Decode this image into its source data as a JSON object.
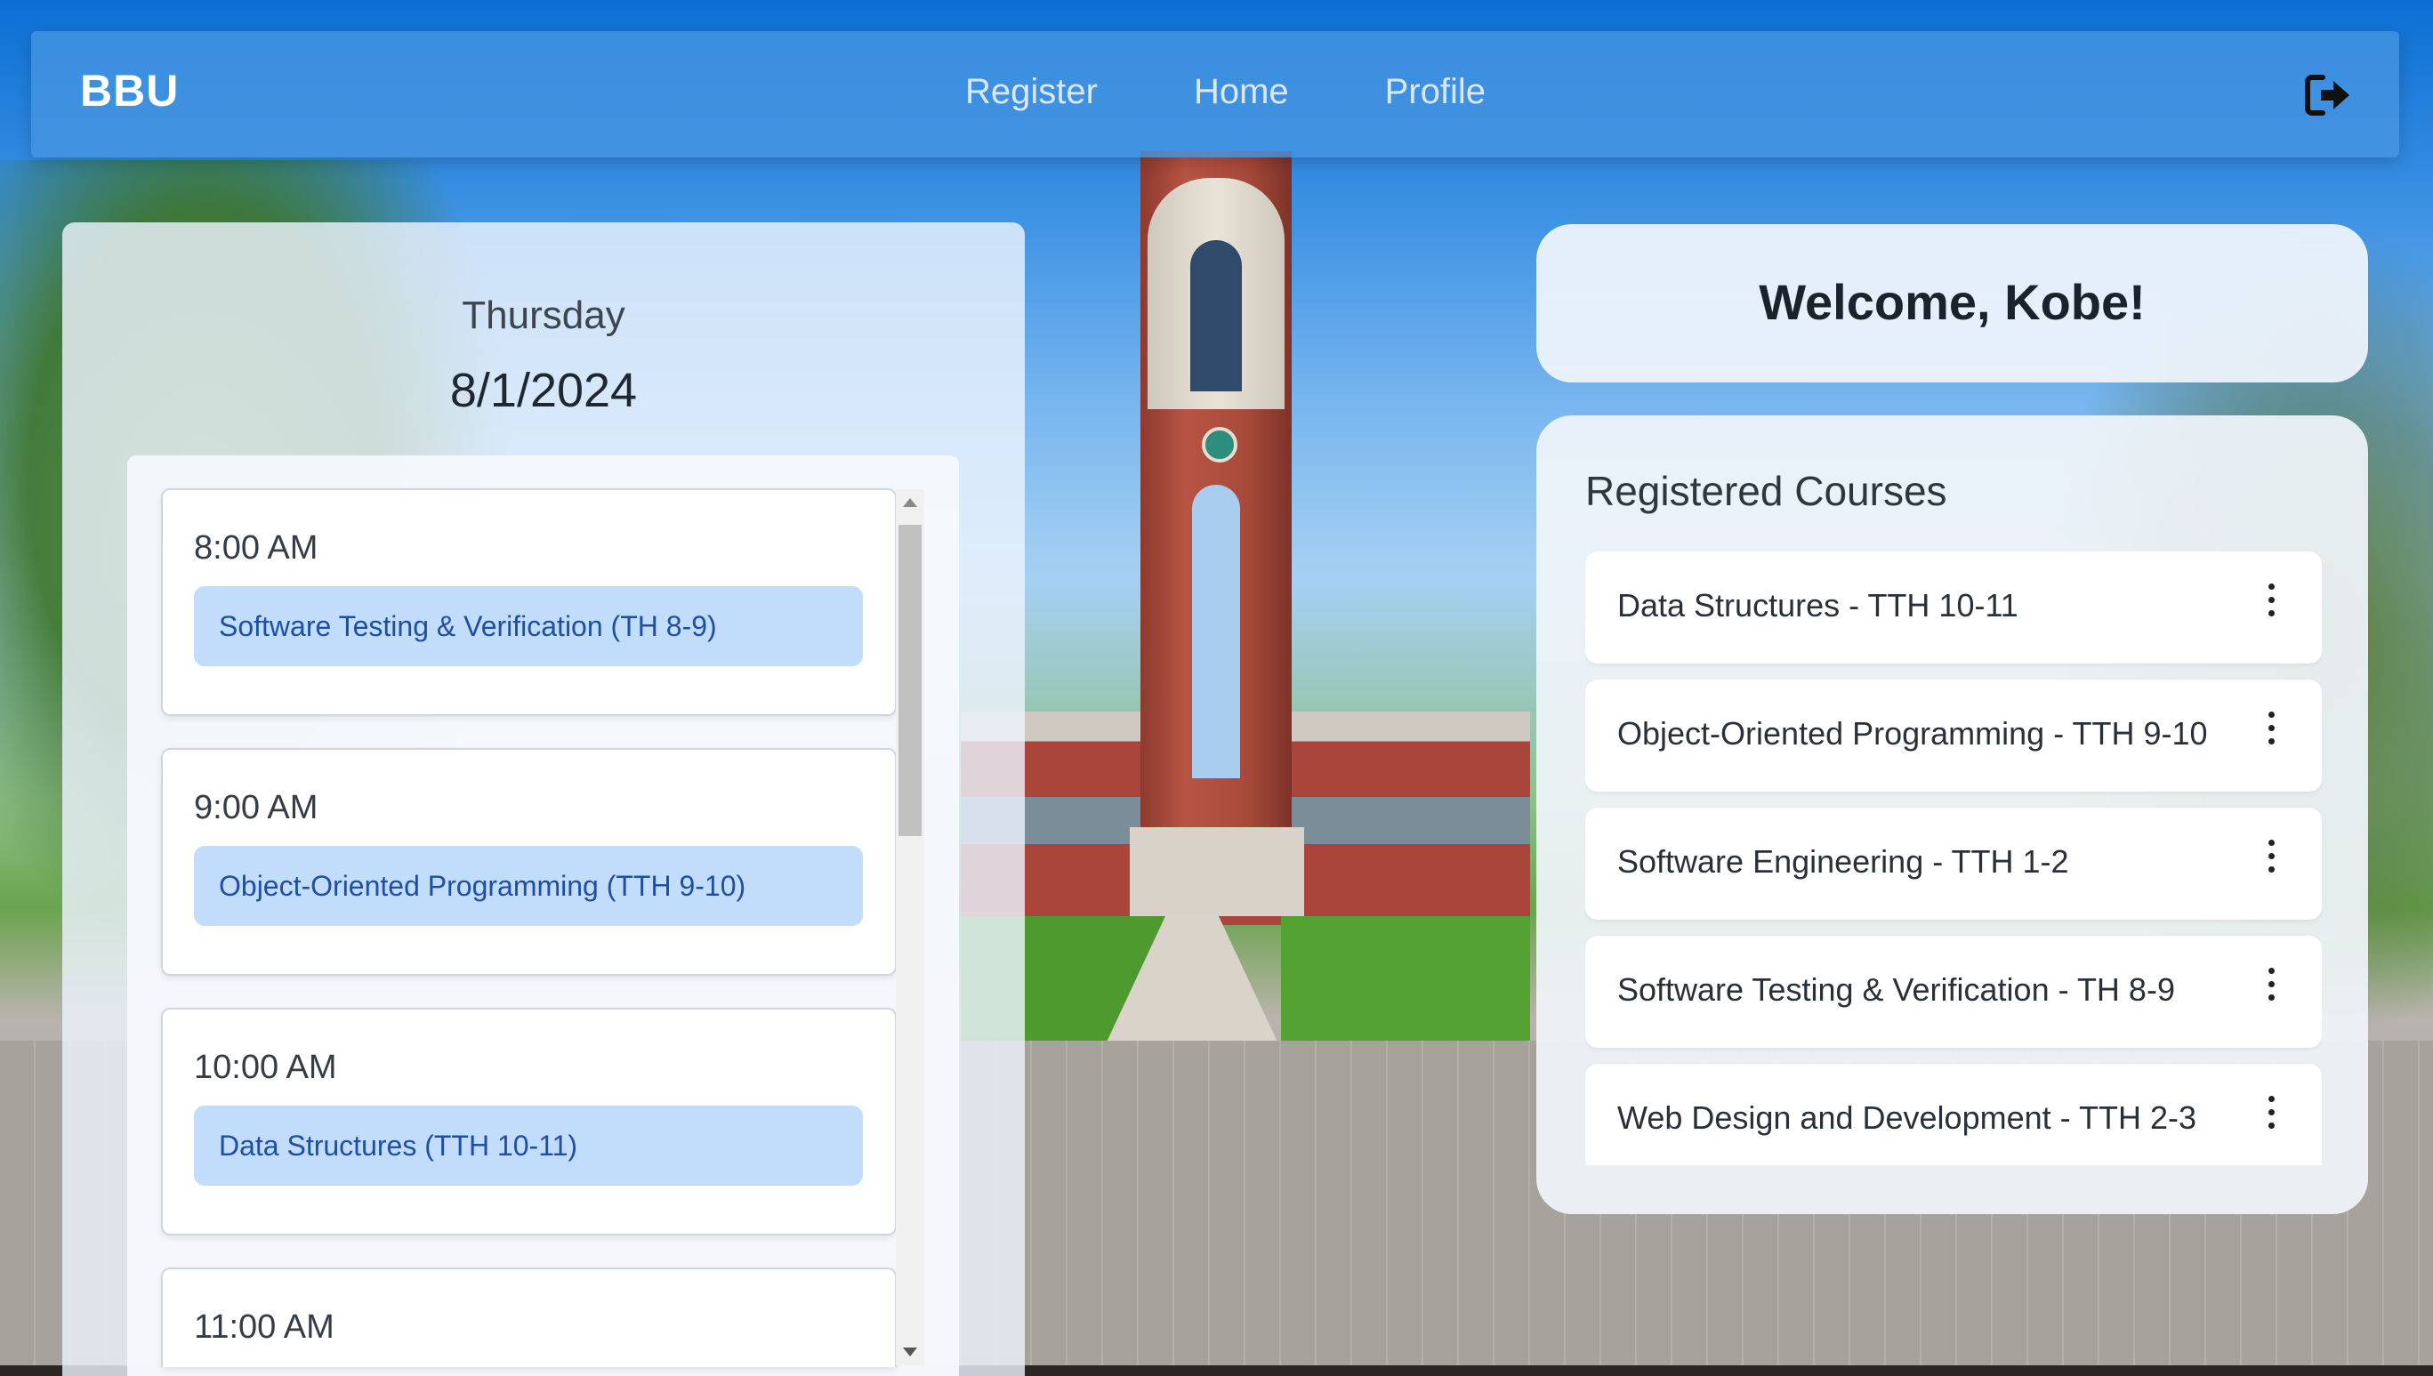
{
  "navbar": {
    "brand": "BBU",
    "links": [
      "Register",
      "Home",
      "Profile"
    ],
    "logout_icon": "logout-icon"
  },
  "schedule": {
    "day": "Thursday",
    "date": "8/1/2024",
    "slots": [
      {
        "time": "8:00 AM",
        "course": "Software Testing & Verification (TH 8-9)"
      },
      {
        "time": "9:00 AM",
        "course": "Object-Oriented Programming (TTH 9-10)"
      },
      {
        "time": "10:00 AM",
        "course": "Data Structures (TTH 10-11)"
      },
      {
        "time": "11:00 AM",
        "course": ""
      }
    ]
  },
  "welcome": {
    "text": "Welcome, Kobe!"
  },
  "registered": {
    "title": "Registered Courses",
    "courses": [
      "Data Structures - TTH 10-11",
      "Object-Oriented Programming - TTH 9-10",
      "Software Engineering - TTH 1-2",
      "Software Testing & Verification - TH 8-9",
      "Web Design and Development - TTH 2-3"
    ]
  },
  "colors": {
    "navbar": "#4696e1",
    "course_chip": "#c2dcfb",
    "course_chip_text": "#1f4fa3"
  }
}
